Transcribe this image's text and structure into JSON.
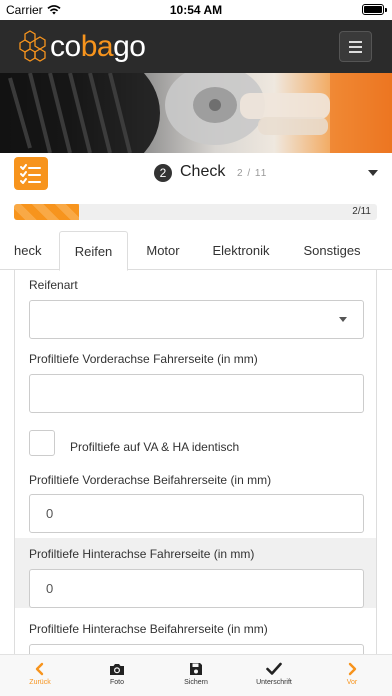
{
  "status_bar": {
    "carrier": "Carrier",
    "time": "10:54 AM"
  },
  "app": {
    "logo_text_a": "co",
    "logo_text_b": "ba",
    "logo_text_c": "go"
  },
  "step": {
    "number": "2",
    "title": "Check",
    "count": "2 / 11"
  },
  "progress": {
    "label": "2/11",
    "fraction": 0.18
  },
  "tabs": [
    {
      "label": "heck"
    },
    {
      "label": "Reifen"
    },
    {
      "label": "Motor"
    },
    {
      "label": "Elektronik"
    },
    {
      "label": "Sonstiges"
    }
  ],
  "form": {
    "reifenart_label": "Reifenart",
    "reifenart_value": "",
    "va_fahrer_label": "Profiltiefe Vorderachse Fahrerseite (in mm)",
    "va_fahrer_value": "",
    "identisch_label": "Profiltiefe auf VA & HA identisch",
    "va_beifahrer_label": "Profiltiefe Vorderachse Beifahrerseite (in mm)",
    "va_beifahrer_value": "0",
    "ha_fahrer_label": "Profiltiefe Hinterachse Fahrerseite (in mm)",
    "ha_fahrer_value": "0",
    "ha_beifahrer_label": "Profiltiefe Hinterachse Beifahrerseite (in mm)"
  },
  "bottom_bar": {
    "back": "Zurück",
    "photo": "Foto",
    "save": "Sichern",
    "signature": "Unterschrift",
    "next": "Vor"
  },
  "colors": {
    "accent": "#f7941d",
    "header": "#2b2b2b"
  },
  "icons": [
    "wifi-icon",
    "battery-icon",
    "hexagon-logo-icon",
    "hamburger-menu-icon",
    "checklist-icon",
    "chevron-down-icon",
    "chevron-left-icon",
    "camera-icon",
    "floppy-disk-icon",
    "checkmark-icon",
    "chevron-right-icon"
  ]
}
